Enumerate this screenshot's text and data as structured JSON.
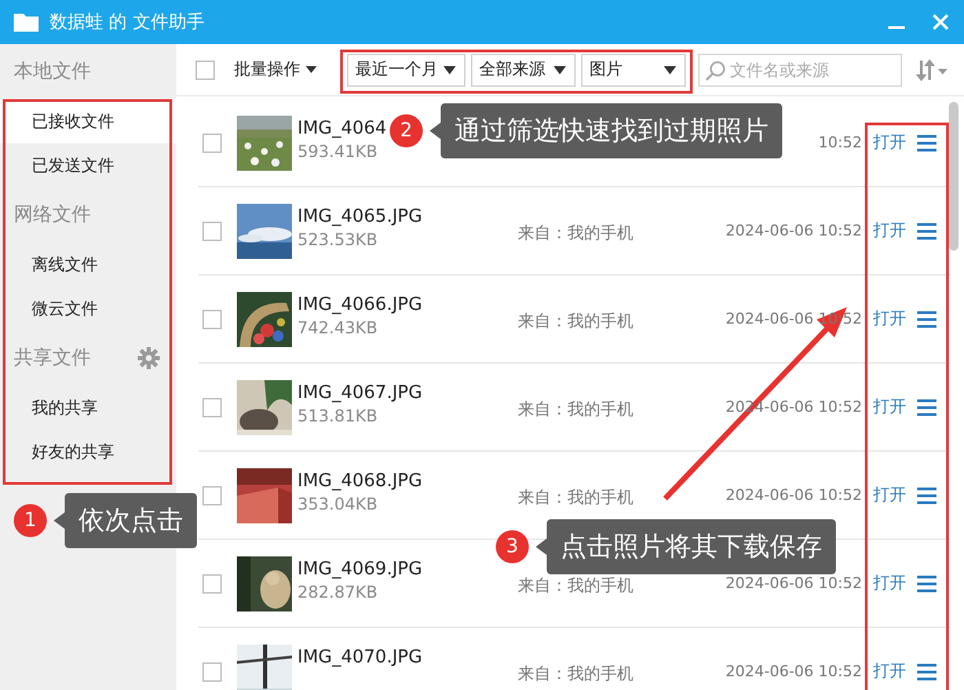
{
  "window": {
    "title": "数据蛙 的 文件助手"
  },
  "sidebar": {
    "sections": [
      {
        "heading": "本地文件",
        "settings": false,
        "items": [
          {
            "label": "已接收文件",
            "selected": true
          },
          {
            "label": "已发送文件",
            "selected": false
          }
        ]
      },
      {
        "heading": "网络文件",
        "settings": false,
        "items": [
          {
            "label": "离线文件",
            "selected": false
          },
          {
            "label": "微云文件",
            "selected": false
          }
        ]
      },
      {
        "heading": "共享文件",
        "settings": true,
        "items": [
          {
            "label": "我的共享",
            "selected": false
          },
          {
            "label": "好友的共享",
            "selected": false
          }
        ]
      }
    ]
  },
  "toolbar": {
    "select_all_checked": false,
    "batch_button": "批量操作",
    "filters": [
      {
        "value": "最近一个月"
      },
      {
        "value": "全部来源"
      },
      {
        "value": "图片"
      }
    ],
    "search": {
      "placeholder": "文件名或来源"
    }
  },
  "files": [
    {
      "name": "IMG_4064",
      "size": "593.41KB",
      "date": "10:52",
      "action": "打开",
      "checked": false
    },
    {
      "name": "IMG_4065.JPG",
      "size": "523.53KB",
      "source": "来自：我的手机",
      "date": "2024-06-06 10:52",
      "action": "打开",
      "checked": false
    },
    {
      "name": "IMG_4066.JPG",
      "size": "742.43KB",
      "source": "来自：我的手机",
      "date": "2024-06-06 10:52",
      "action": "打开",
      "checked": false
    },
    {
      "name": "IMG_4067.JPG",
      "size": "513.81KB",
      "source": "来自：我的手机",
      "date": "2024-06-06 10:52",
      "action": "打开",
      "checked": false
    },
    {
      "name": "IMG_4068.JPG",
      "size": "353.04KB",
      "source": "来自：我的手机",
      "date": "2024-06-06 10:52",
      "action": "打开",
      "checked": false
    },
    {
      "name": "IMG_4069.JPG",
      "size": "282.87KB",
      "source": "来自：我的手机",
      "date": "2024-06-06 10:52",
      "action": "打开",
      "checked": false
    },
    {
      "name": "IMG_4070.JPG",
      "source": "来自：我的手机",
      "date": "2024-06-06 10:52",
      "action": "打开",
      "checked": false
    }
  ],
  "annotations": [
    {
      "step": "1",
      "text": "依次点击"
    },
    {
      "step": "2",
      "text": "通过筛选快速找到过期照片"
    },
    {
      "step": "3",
      "text": "点击照片将其下载保存"
    }
  ]
}
